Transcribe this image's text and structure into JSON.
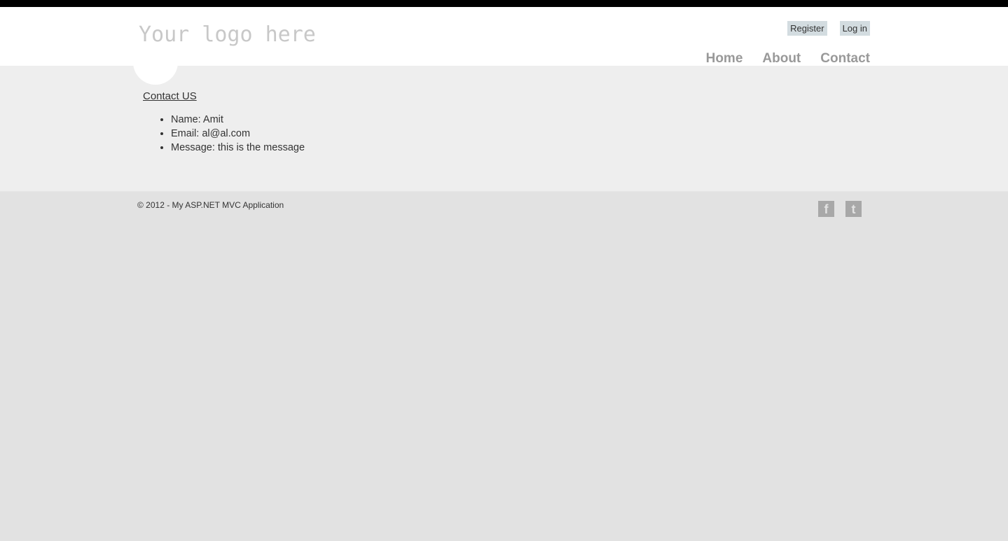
{
  "header": {
    "logo_text": "Your logo here",
    "login": {
      "register_label": "Register",
      "login_label": "Log in"
    },
    "menu": [
      {
        "label": "Home"
      },
      {
        "label": "About"
      },
      {
        "label": "Contact"
      }
    ]
  },
  "main": {
    "title_link": "Contact US",
    "details": [
      "Name: Amit",
      "Email: al@al.com",
      "Message: this is the message"
    ]
  },
  "footer": {
    "copyright": "© 2012 - My ASP.NET MVC Application",
    "social": [
      {
        "icon": "facebook-icon",
        "glyph": "f"
      },
      {
        "icon": "twitter-icon",
        "glyph": "t"
      }
    ]
  },
  "colors": {
    "topbar": "#000000",
    "header_bg": "#ffffff",
    "main_bg": "#eeeeee",
    "footer_bg": "#e2e2e2",
    "menu_text": "#999999",
    "login_bg": "#d3dce0",
    "logo_text": "#c8c8c8"
  }
}
